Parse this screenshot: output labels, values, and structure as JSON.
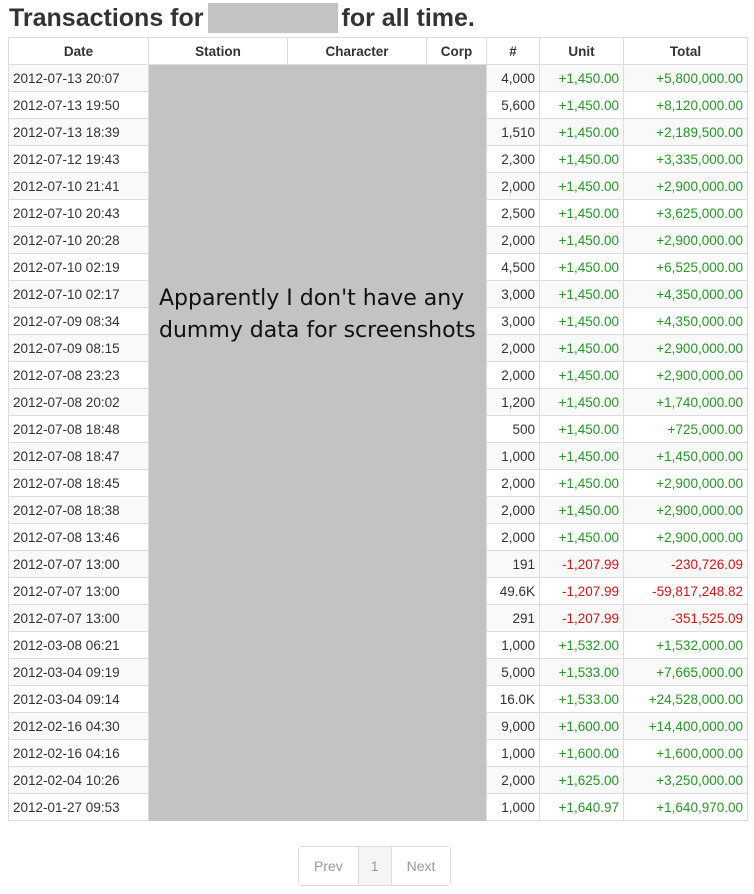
{
  "page": {
    "title_prefix": "Transactions for",
    "title_suffix": "for all time."
  },
  "redaction_note": "Apparently I don't have any dummy data for screenshots",
  "table": {
    "columns": [
      "Date",
      "Station",
      "Character",
      "Corp",
      "#",
      "Unit",
      "Total"
    ],
    "rows": [
      {
        "date": "2012-07-13 20:07",
        "qty": "4,000",
        "unit": "+1,450.00",
        "total": "+5,800,000.00",
        "sign": "pos"
      },
      {
        "date": "2012-07-13 19:50",
        "qty": "5,600",
        "unit": "+1,450.00",
        "total": "+8,120,000.00",
        "sign": "pos"
      },
      {
        "date": "2012-07-13 18:39",
        "qty": "1,510",
        "unit": "+1,450.00",
        "total": "+2,189,500.00",
        "sign": "pos"
      },
      {
        "date": "2012-07-12 19:43",
        "qty": "2,300",
        "unit": "+1,450.00",
        "total": "+3,335,000.00",
        "sign": "pos"
      },
      {
        "date": "2012-07-10 21:41",
        "qty": "2,000",
        "unit": "+1,450.00",
        "total": "+2,900,000.00",
        "sign": "pos"
      },
      {
        "date": "2012-07-10 20:43",
        "qty": "2,500",
        "unit": "+1,450.00",
        "total": "+3,625,000.00",
        "sign": "pos"
      },
      {
        "date": "2012-07-10 20:28",
        "qty": "2,000",
        "unit": "+1,450.00",
        "total": "+2,900,000.00",
        "sign": "pos"
      },
      {
        "date": "2012-07-10 02:19",
        "qty": "4,500",
        "unit": "+1,450.00",
        "total": "+6,525,000.00",
        "sign": "pos"
      },
      {
        "date": "2012-07-10 02:17",
        "qty": "3,000",
        "unit": "+1,450.00",
        "total": "+4,350,000.00",
        "sign": "pos"
      },
      {
        "date": "2012-07-09 08:34",
        "qty": "3,000",
        "unit": "+1,450.00",
        "total": "+4,350,000.00",
        "sign": "pos"
      },
      {
        "date": "2012-07-09 08:15",
        "qty": "2,000",
        "unit": "+1,450.00",
        "total": "+2,900,000.00",
        "sign": "pos"
      },
      {
        "date": "2012-07-08 23:23",
        "qty": "2,000",
        "unit": "+1,450.00",
        "total": "+2,900,000.00",
        "sign": "pos"
      },
      {
        "date": "2012-07-08 20:02",
        "qty": "1,200",
        "unit": "+1,450.00",
        "total": "+1,740,000.00",
        "sign": "pos"
      },
      {
        "date": "2012-07-08 18:48",
        "qty": "500",
        "unit": "+1,450.00",
        "total": "+725,000.00",
        "sign": "pos"
      },
      {
        "date": "2012-07-08 18:47",
        "qty": "1,000",
        "unit": "+1,450.00",
        "total": "+1,450,000.00",
        "sign": "pos"
      },
      {
        "date": "2012-07-08 18:45",
        "qty": "2,000",
        "unit": "+1,450.00",
        "total": "+2,900,000.00",
        "sign": "pos"
      },
      {
        "date": "2012-07-08 18:38",
        "qty": "2,000",
        "unit": "+1,450.00",
        "total": "+2,900,000.00",
        "sign": "pos"
      },
      {
        "date": "2012-07-08 13:46",
        "qty": "2,000",
        "unit": "+1,450.00",
        "total": "+2,900,000.00",
        "sign": "pos"
      },
      {
        "date": "2012-07-07 13:00",
        "qty": "191",
        "unit": "-1,207.99",
        "total": "-230,726.09",
        "sign": "neg"
      },
      {
        "date": "2012-07-07 13:00",
        "qty": "49.6K",
        "unit": "-1,207.99",
        "total": "-59,817,248.82",
        "sign": "neg"
      },
      {
        "date": "2012-07-07 13:00",
        "qty": "291",
        "unit": "-1,207.99",
        "total": "-351,525.09",
        "sign": "neg"
      },
      {
        "date": "2012-03-08 06:21",
        "qty": "1,000",
        "unit": "+1,532.00",
        "total": "+1,532,000.00",
        "sign": "pos"
      },
      {
        "date": "2012-03-04 09:19",
        "qty": "5,000",
        "unit": "+1,533.00",
        "total": "+7,665,000.00",
        "sign": "pos"
      },
      {
        "date": "2012-03-04 09:14",
        "qty": "16.0K",
        "unit": "+1,533.00",
        "total": "+24,528,000.00",
        "sign": "pos"
      },
      {
        "date": "2012-02-16 04:30",
        "qty": "9,000",
        "unit": "+1,600.00",
        "total": "+14,400,000.00",
        "sign": "pos"
      },
      {
        "date": "2012-02-16 04:16",
        "qty": "1,000",
        "unit": "+1,600.00",
        "total": "+1,600,000.00",
        "sign": "pos"
      },
      {
        "date": "2012-02-04 10:26",
        "qty": "2,000",
        "unit": "+1,625.00",
        "total": "+3,250,000.00",
        "sign": "pos"
      },
      {
        "date": "2012-01-27 09:53",
        "qty": "1,000",
        "unit": "+1,640.97",
        "total": "+1,640,970.00",
        "sign": "pos"
      }
    ]
  },
  "pagination": {
    "prev": "Prev",
    "current": "1",
    "next": "Next"
  },
  "colors": {
    "positive": "#229922",
    "negative": "#dd1111",
    "redaction": "#c3c3c3"
  }
}
